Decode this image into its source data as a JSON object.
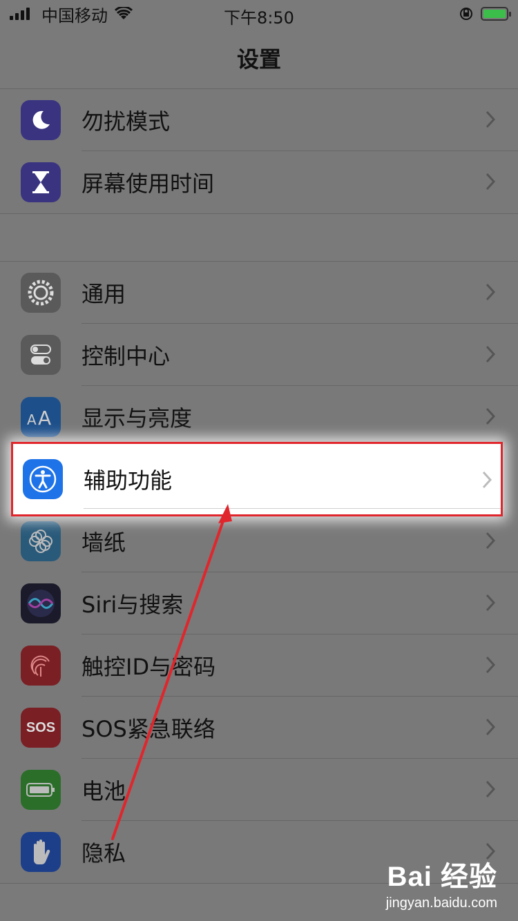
{
  "status": {
    "carrier": "中国移动",
    "time": "下午8:50"
  },
  "nav": {
    "title": "设置"
  },
  "group1": [
    {
      "label": "勿扰模式",
      "icon": "moon-icon",
      "color": "#3a3480"
    },
    {
      "label": "屏幕使用时间",
      "icon": "hourglass-icon",
      "color": "#3a3480"
    }
  ],
  "group2": [
    {
      "label": "通用",
      "icon": "gear-icon",
      "color": "#5a5a5a"
    },
    {
      "label": "控制中心",
      "icon": "toggles-icon",
      "color": "#5a5a5a"
    },
    {
      "label": "显示与亮度",
      "icon": "text-size-icon",
      "color": "#1d4f8a"
    },
    {
      "label": "辅助功能",
      "icon": "accessibility-icon",
      "color": "#1e73e8"
    },
    {
      "label": "墙纸",
      "icon": "flower-icon",
      "color": "#2a5a7a"
    },
    {
      "label": "Siri与搜索",
      "icon": "siri-icon",
      "color": "#1a1a2a"
    },
    {
      "label": "触控ID与密码",
      "icon": "fingerprint-icon",
      "color": "#7a1f24"
    },
    {
      "label": "SOS紧急联络",
      "icon": "sos-icon",
      "color": "#7a1f24",
      "icon_text": "SOS"
    },
    {
      "label": "电池",
      "icon": "battery-icon",
      "color": "#2a6e2a"
    },
    {
      "label": "隐私",
      "icon": "hand-icon",
      "color": "#1d3f8a"
    }
  ],
  "watermark": {
    "logo": "Bai 经验",
    "url": "jingyan.baidu.com"
  },
  "colors": {
    "highlight_border": "#e0262c",
    "arrow": "#e0262c"
  }
}
